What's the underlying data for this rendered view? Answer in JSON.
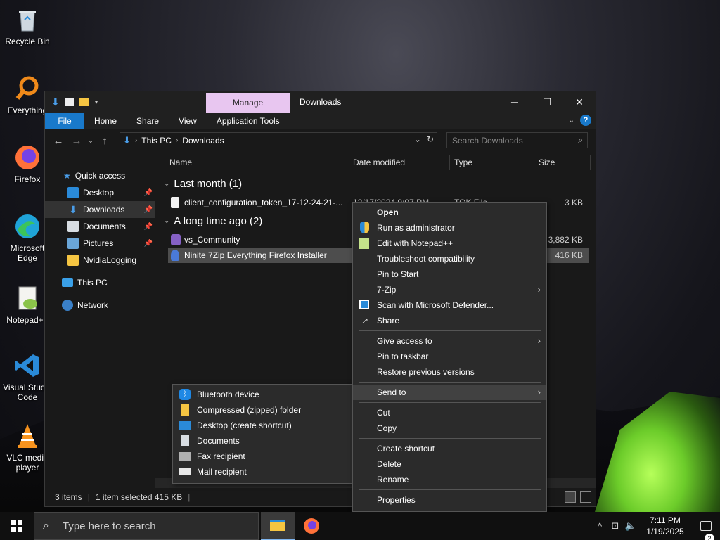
{
  "desktop": {
    "icons": [
      {
        "label": "Recycle Bin"
      },
      {
        "label": "Everything"
      },
      {
        "label": "Firefox"
      },
      {
        "label": "Microsoft Edge"
      },
      {
        "label": "Notepad++"
      },
      {
        "label": "Visual Studio Code"
      },
      {
        "label": "VLC media player"
      }
    ]
  },
  "explorer": {
    "manage_tab": "Manage",
    "title": "Downloads",
    "ribbon_tabs": [
      "File",
      "Home",
      "Share",
      "View",
      "Application Tools"
    ],
    "address": {
      "parts": [
        "This PC",
        "Downloads"
      ]
    },
    "search_placeholder": "Search Downloads",
    "nav": [
      {
        "label": "Quick access"
      },
      {
        "label": "Desktop",
        "pinned": true
      },
      {
        "label": "Downloads",
        "pinned": true,
        "selected": true
      },
      {
        "label": "Documents",
        "pinned": true
      },
      {
        "label": "Pictures",
        "pinned": true
      },
      {
        "label": "NvidiaLogging"
      },
      {
        "label": "This PC"
      },
      {
        "label": "Network"
      }
    ],
    "columns": {
      "name": "Name",
      "date": "Date modified",
      "type": "Type",
      "size": "Size"
    },
    "groups": [
      {
        "label": "Last month (1)"
      },
      {
        "label": "A long time ago (2)"
      }
    ],
    "files": [
      {
        "name": "client_configuration_token_17-12-24-21-...",
        "date": "12/17/2024 9:07 PM",
        "type": "TOK File",
        "size": "3 KB"
      },
      {
        "name": "vs_Community",
        "date": "",
        "type": "",
        "size": "3,882 KB"
      },
      {
        "name": "Ninite 7Zip Everything Firefox Installer",
        "date": "",
        "type": "",
        "size": "416 KB"
      }
    ],
    "status": {
      "count": "3 items",
      "selected": "1 item selected  415 KB"
    }
  },
  "context_menu": {
    "items": [
      {
        "label": "Open",
        "bold": true
      },
      {
        "label": "Run as administrator",
        "icon": "shield-icon"
      },
      {
        "label": "Edit with Notepad++",
        "icon": "notepad-icon"
      },
      {
        "label": "Troubleshoot compatibility"
      },
      {
        "label": "Pin to Start"
      },
      {
        "label": "7-Zip",
        "submenu": true
      },
      {
        "label": "Scan with Microsoft Defender...",
        "icon": "defender-icon"
      },
      {
        "label": "Share",
        "icon": "share-icon"
      },
      {
        "divider": true
      },
      {
        "label": "Give access to",
        "submenu": true
      },
      {
        "label": "Pin to taskbar"
      },
      {
        "label": "Restore previous versions"
      },
      {
        "divider": true
      },
      {
        "label": "Send to",
        "submenu": true,
        "hover": true
      },
      {
        "divider": true
      },
      {
        "label": "Cut"
      },
      {
        "label": "Copy"
      },
      {
        "divider": true
      },
      {
        "label": "Create shortcut"
      },
      {
        "label": "Delete"
      },
      {
        "label": "Rename"
      },
      {
        "divider": true
      },
      {
        "label": "Properties"
      }
    ]
  },
  "send_to_menu": {
    "items": [
      {
        "label": "Bluetooth device",
        "icon": "bluetooth-icon"
      },
      {
        "label": "Compressed (zipped) folder",
        "icon": "zip-folder-icon"
      },
      {
        "label": "Desktop (create shortcut)",
        "icon": "desktop-icon"
      },
      {
        "label": "Documents",
        "icon": "documents-icon"
      },
      {
        "label": "Fax recipient",
        "icon": "fax-icon"
      },
      {
        "label": "Mail recipient",
        "icon": "mail-icon"
      }
    ]
  },
  "taskbar": {
    "search_placeholder": "Type here to search",
    "time": "7:11 PM",
    "date": "1/19/2025",
    "notification_count": "2"
  },
  "colors": {
    "accent": "#1979ca",
    "manage_tab": "#e8c6f0",
    "folder": "#f5c542"
  }
}
